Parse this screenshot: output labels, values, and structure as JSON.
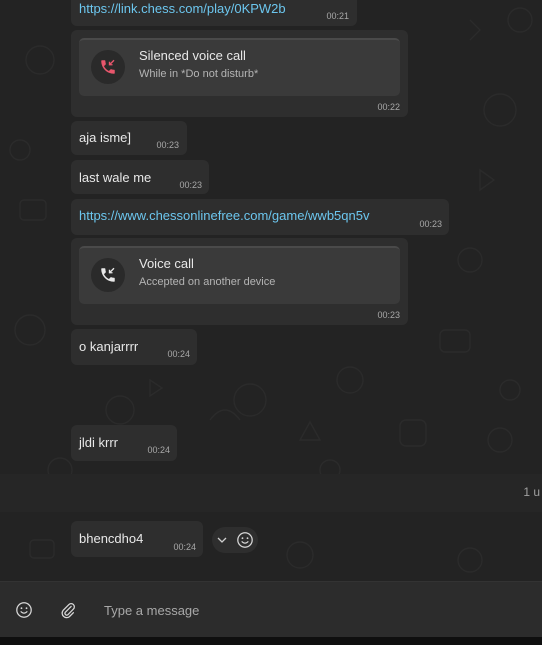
{
  "messages": [
    {
      "kind": "link",
      "text": "https://link.chess.com/play/0KPW2b",
      "time": "00:21"
    },
    {
      "kind": "call",
      "title": "Silenced voice call",
      "subtitle": "While in *Do not disturb*",
      "time": "00:22",
      "icon": "missed-call-icon",
      "icon_color": "#e8566c"
    },
    {
      "kind": "text",
      "text": "aja isme]",
      "time": "00:23"
    },
    {
      "kind": "text",
      "text": "last wale me",
      "time": "00:23"
    },
    {
      "kind": "link",
      "text": "https://www.chessonlinefree.com/game/wwb5qn5v",
      "time": "00:23"
    },
    {
      "kind": "call",
      "title": "Voice call",
      "subtitle": "Accepted on another device",
      "time": "00:23",
      "icon": "incoming-call-icon",
      "icon_color": "#e8e8e8"
    },
    {
      "kind": "text",
      "text": "o kanjarrrr",
      "time": "00:24"
    },
    {
      "kind": "text",
      "text": "jldi krrr",
      "time": "00:24"
    },
    {
      "kind": "text",
      "text": "bhencdho4",
      "time": "00:24"
    }
  ],
  "unread_label": "1 u",
  "reaction": {
    "dropdown_icon": "chevron-down-icon",
    "emoji_icon": "smiley-icon"
  },
  "composer": {
    "emoji_icon": "smiley-icon",
    "attach_icon": "paperclip-icon",
    "placeholder": "Type a message"
  },
  "colors": {
    "link": "#6cc6ee",
    "bubble": "#2e2e2e",
    "call_card": "#3a3a3a",
    "missed": "#e8566c"
  }
}
